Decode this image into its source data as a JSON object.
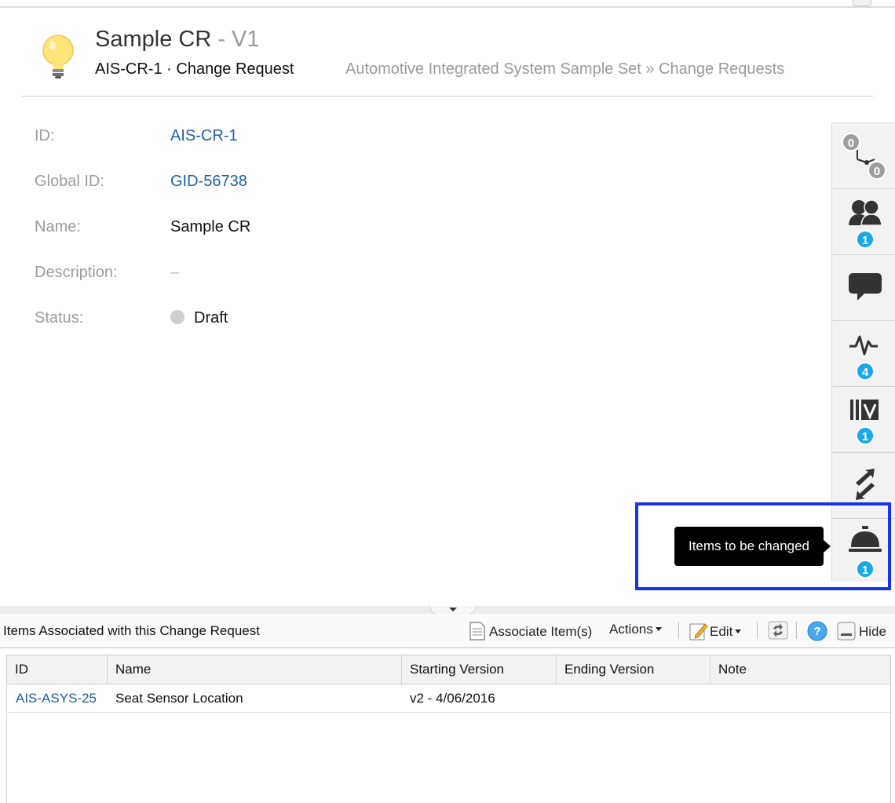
{
  "header": {
    "title": "Sample CR",
    "version": "- V1",
    "item_id": "AIS-CR-1",
    "separator": "·",
    "item_type": "Change Request",
    "breadcrumb": "Automotive Integrated System Sample Set » Change Requests"
  },
  "fields": {
    "id": {
      "label": "ID:",
      "value": "AIS-CR-1"
    },
    "global_id": {
      "label": "Global ID:",
      "value": "GID-56738"
    },
    "name": {
      "label": "Name:",
      "value": "Sample CR"
    },
    "description": {
      "label": "Description:",
      "value": "–"
    },
    "status": {
      "label": "Status:",
      "value": "Draft"
    }
  },
  "rail": {
    "relationships": {
      "upstream": "0",
      "downstream": "0"
    },
    "users": {
      "badge": "1"
    },
    "comments": {},
    "activity": {
      "badge": "4"
    },
    "versions": {
      "badge": "1"
    },
    "sync": {},
    "items_to_change": {
      "badge": "1",
      "tooltip": "Items to be changed"
    }
  },
  "panel": {
    "title": "Items Associated with this Change Request",
    "associate_label": "Associate Item(s)",
    "actions_label": "Actions",
    "edit_label": "Edit",
    "hide_label": "Hide"
  },
  "table": {
    "columns": [
      "ID",
      "Name",
      "Starting Version",
      "Ending Version",
      "Note"
    ],
    "rows": [
      {
        "id": "AIS-ASYS-25",
        "name": "Seat Sensor Location",
        "starting_version": "v2 - 4/06/2016",
        "ending_version": "",
        "note": ""
      }
    ]
  },
  "colors": {
    "link": "#1f5fa8",
    "badge": "#19a9e8",
    "highlight": "#1833ee",
    "bulb": "#ffe47a"
  }
}
